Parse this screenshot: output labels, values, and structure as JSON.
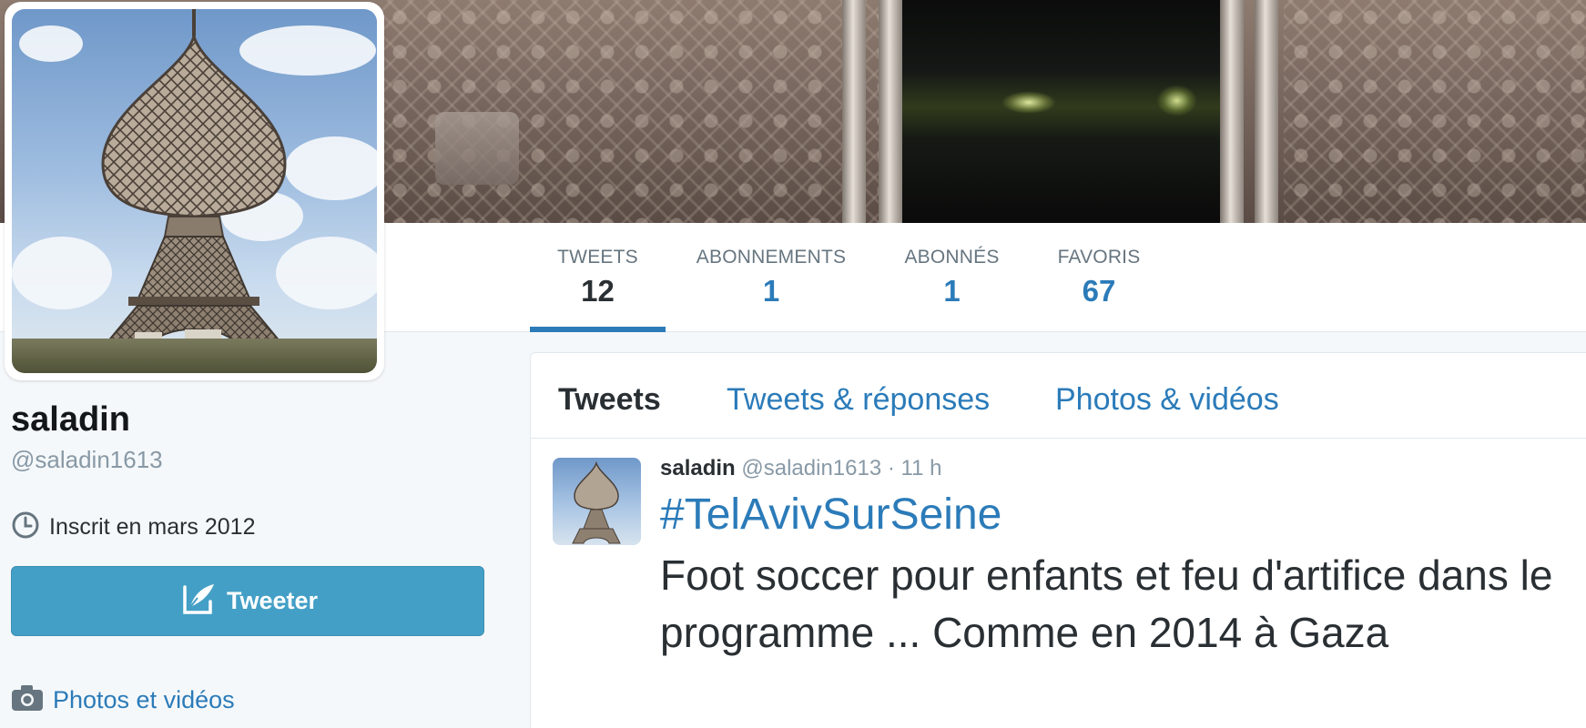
{
  "profile": {
    "name": "saladin",
    "handle": "@saladin1613",
    "joined": "Inscrit en mars 2012",
    "tweet_button_label": "Tweeter",
    "photos_link": "Photos et vidéos"
  },
  "stats": [
    {
      "label": "TWEETS",
      "value": "12",
      "active": true
    },
    {
      "label": "ABONNEMENTS",
      "value": "1",
      "active": false
    },
    {
      "label": "ABONNÉS",
      "value": "1",
      "active": false
    },
    {
      "label": "FAVORIS",
      "value": "67",
      "active": false
    }
  ],
  "timeline": {
    "tabs": [
      {
        "label": "Tweets",
        "active": true
      },
      {
        "label": "Tweets & réponses",
        "active": false
      },
      {
        "label": "Photos & vidéos",
        "active": false
      }
    ],
    "tweet": {
      "name": "saladin",
      "handle": "@saladin1613",
      "separator": "·",
      "time": "11 h",
      "hashtag": "#TelAvivSurSeine",
      "text": "Foot soccer pour enfants et feu d'artifice dans le programme ... Comme en 2014 à Gaza"
    }
  },
  "icons": {
    "clock": "clock-icon",
    "compose": "compose-quill-icon",
    "camera": "camera-icon"
  },
  "colors": {
    "accent": "#2b7bb9",
    "button": "#439fc6",
    "muted": "#8899a6",
    "text": "#292f33",
    "background": "#f5f8fa"
  }
}
